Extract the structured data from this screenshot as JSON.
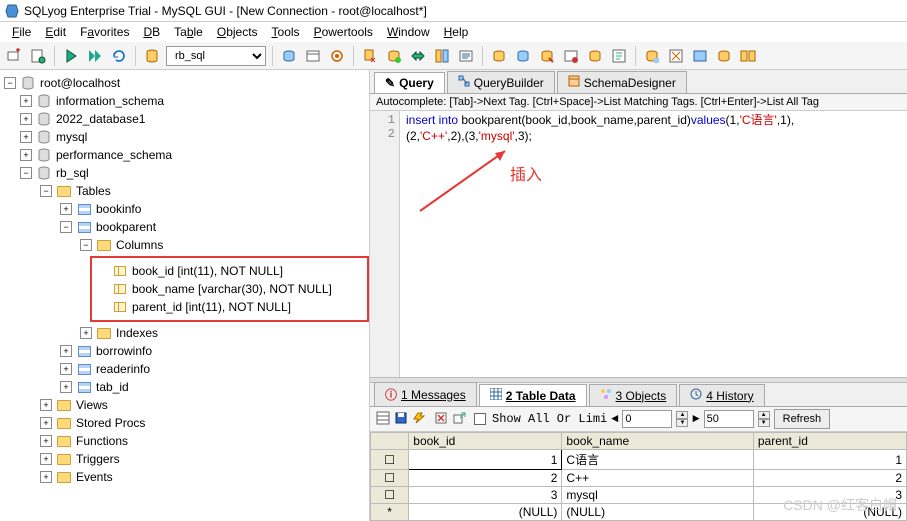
{
  "title": "SQLyog Enterprise Trial - MySQL GUI - [New Connection - root@localhost*]",
  "menu": [
    "File",
    "Edit",
    "Favorites",
    "DB",
    "Table",
    "Objects",
    "Tools",
    "Powertools",
    "Window",
    "Help"
  ],
  "db_selector": "rb_sql",
  "tree": {
    "root": "root@localhost",
    "dbs": [
      "information_schema",
      "2022_database1",
      "mysql",
      "performance_schema"
    ],
    "current_db": "rb_sql",
    "tables_label": "Tables",
    "tables": [
      "bookinfo",
      "bookparent"
    ],
    "columns_label": "Columns",
    "columns": [
      "book_id [int(11), NOT NULL]",
      "book_name [varchar(30), NOT NULL]",
      "parent_id [int(11), NOT NULL]"
    ],
    "indexes_label": "Indexes",
    "other_tables": [
      "borrowinfo",
      "readerinfo",
      "tab_id"
    ],
    "folders": [
      "Views",
      "Stored Procs",
      "Functions",
      "Triggers",
      "Events"
    ]
  },
  "query_tabs": [
    "Query",
    "QueryBuilder",
    "SchemaDesigner"
  ],
  "autocomplete_hint": "Autocomplete: [Tab]->Next Tag. [Ctrl+Space]->List Matching Tags. [Ctrl+Enter]->List All Tag",
  "sql": {
    "line1_a": "insert into",
    "line1_b": " bookparent(book_id,book_name,parent_id)",
    "line1_c": "values",
    "line1_d": "(1,",
    "line1_e": "'C语言'",
    "line1_f": ",1),",
    "line2_a": "(2,",
    "line2_b": "'C++'",
    "line2_c": ",2),(3,",
    "line2_d": "'mysql'",
    "line2_e": ",3);"
  },
  "annotation": "插入",
  "result_tabs": {
    "messages": "1 Messages",
    "tabledata": "2 Table Data",
    "objects": "3 Objects",
    "history": "4 History"
  },
  "result_toolbar": {
    "showall": "Show All Or Limi",
    "from": "0",
    "to": "50",
    "refresh": "Refresh"
  },
  "grid": {
    "headers": [
      "book_id",
      "book_name",
      "parent_id"
    ],
    "rows": [
      {
        "id": "1",
        "name": "C语言",
        "pid": "1"
      },
      {
        "id": "2",
        "name": "C++",
        "pid": "2"
      },
      {
        "id": "3",
        "name": "mysql",
        "pid": "3"
      }
    ],
    "nullrow": "(NULL)"
  },
  "watermark": "CSDN @红客白帽"
}
